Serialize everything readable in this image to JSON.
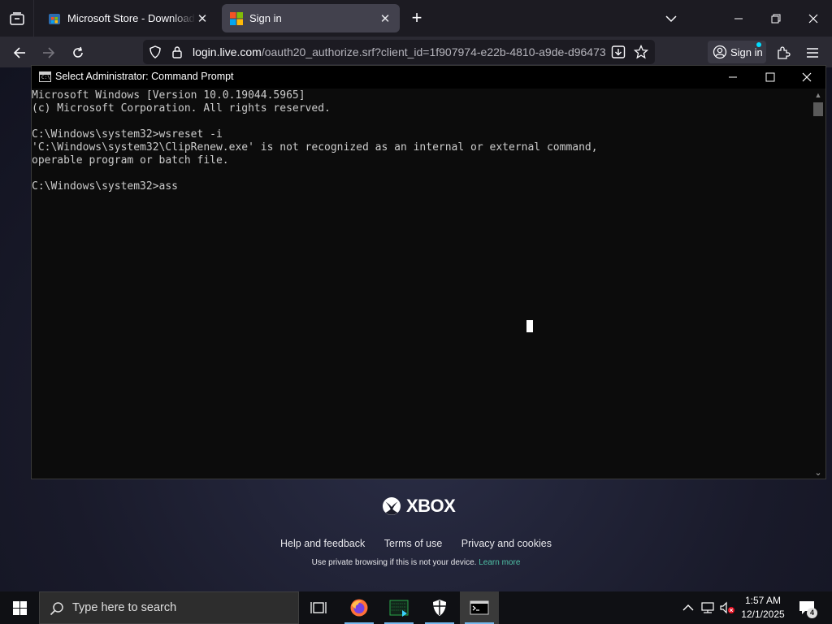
{
  "browser": {
    "tabs": [
      {
        "title": "Microsoft Store - Download apps",
        "icon": "microsoft-store-icon",
        "active": false
      },
      {
        "title": "Sign in",
        "icon": "microsoft-logo-icon",
        "active": true
      }
    ],
    "url": {
      "host": "login.live.com",
      "path": "/oauth20_authorize.srf?client_id=1f907974-e22b-4810-a9de-d96473"
    },
    "signin_label": "Sign in"
  },
  "console": {
    "title": "Select Administrator: Command Prompt",
    "lines": [
      "Microsoft Windows [Version 10.0.19044.5965]",
      "(c) Microsoft Corporation. All rights reserved.",
      "",
      "C:\\Windows\\system32>wsreset -i",
      "'C:\\Windows\\system32\\ClipRenew.exe' is not recognized as an internal or external command,",
      "operable program or batch file.",
      "",
      "C:\\Windows\\system32>ass"
    ]
  },
  "page": {
    "brand": "XBOX",
    "footer_links": [
      "Help and feedback",
      "Terms of use",
      "Privacy and cookies"
    ],
    "private_note": "Use private browsing if this is not your device.",
    "learn_more": "Learn more"
  },
  "taskbar": {
    "search_placeholder": "Type here to search",
    "apps": [
      "task-view-icon",
      "firefox-icon",
      "app-icon",
      "security-icon",
      "command-prompt-icon"
    ],
    "clock_time": "1:57 AM",
    "clock_date": "12/1/2025",
    "notification_count": "4"
  },
  "colors": {
    "console_bg": "#0c0c0c",
    "console_text": "#cccccc",
    "accent_link": "#4fc1a6",
    "taskbar_bg": "#0f1014"
  }
}
